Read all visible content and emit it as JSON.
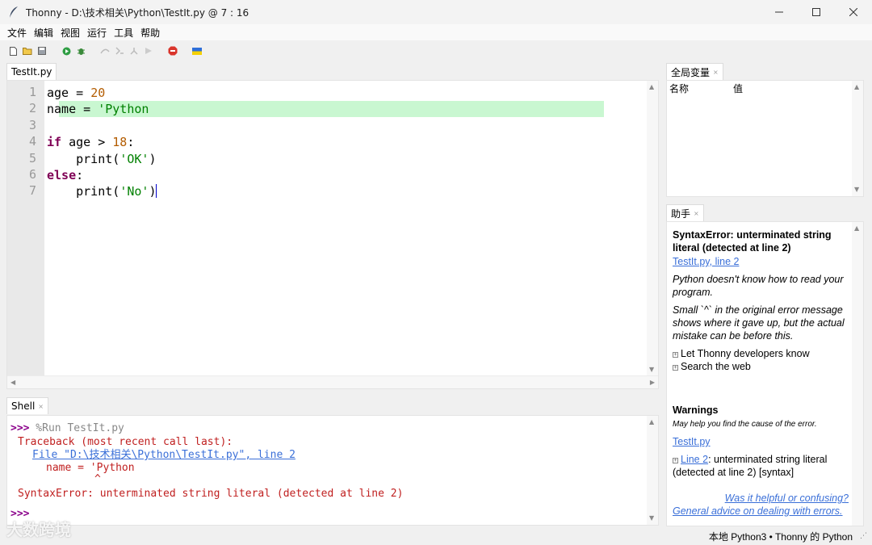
{
  "window": {
    "title": "Thonny  -  D:\\技术相关\\Python\\TestIt.py  @  7 : 16"
  },
  "menu": [
    "文件",
    "编辑",
    "视图",
    "运行",
    "工具",
    "帮助"
  ],
  "toolbar_icons": [
    "new-file-icon",
    "open-file-icon",
    "save-icon",
    "run-icon",
    "debug-icon",
    "step-over-icon",
    "step-into-icon",
    "step-out-icon",
    "resume-icon",
    "stop-icon",
    "ukraine-flag-icon"
  ],
  "editor": {
    "tab_label": "TestIt.py",
    "line_numbers": [
      "1",
      "2",
      "3",
      "4",
      "5",
      "6",
      "7"
    ],
    "highlighted_line": 2
  },
  "shell": {
    "tab_label": "Shell",
    "prompt": ">>>",
    "run_command": " %Run TestIt.py",
    "traceback_header": "Traceback (most recent call last):",
    "file_link": "File \"D:\\技术相关\\Python\\TestIt.py\", line 2",
    "code_line": "name = 'Python",
    "caret": "^",
    "error_message": "SyntaxError: unterminated string literal (detected at line 2)",
    "final_prompt": ">>>"
  },
  "variables": {
    "tab_label": "全局变量",
    "col_name": "名称",
    "col_value": "值"
  },
  "assistant": {
    "tab_label": "助手",
    "heading": "SyntaxError: unterminated string literal (detected at line 2)",
    "location_link": "TestIt.py, line 2",
    "para1": "Python doesn't know how to read your program.",
    "para2": "Small `^` in the original error message shows where it gave up, but the actual mistake can be before this.",
    "option1": "Let Thonny developers know",
    "option2": "Search the web",
    "warnings_title": "Warnings",
    "warnings_sub": "May help you find the cause of the error.",
    "warn_file_link": "TestIt.py",
    "warn_line_link": "Line 2",
    "warn_text": ": unterminated string literal (detected at line 2)  [syntax]",
    "feedback_link": "Was it helpful or confusing?",
    "advice_link": "General advice on dealing with errors."
  },
  "status": {
    "text": "本地 Python3  •  Thonny 的 Python"
  },
  "watermark": "大数跨境",
  "colors": {
    "keyword": "#7f0055",
    "number": "#b35c00",
    "string": "#008000",
    "error": "#c02020",
    "link": "#3a6fd8",
    "line_highlight": "#c9f7d1"
  }
}
